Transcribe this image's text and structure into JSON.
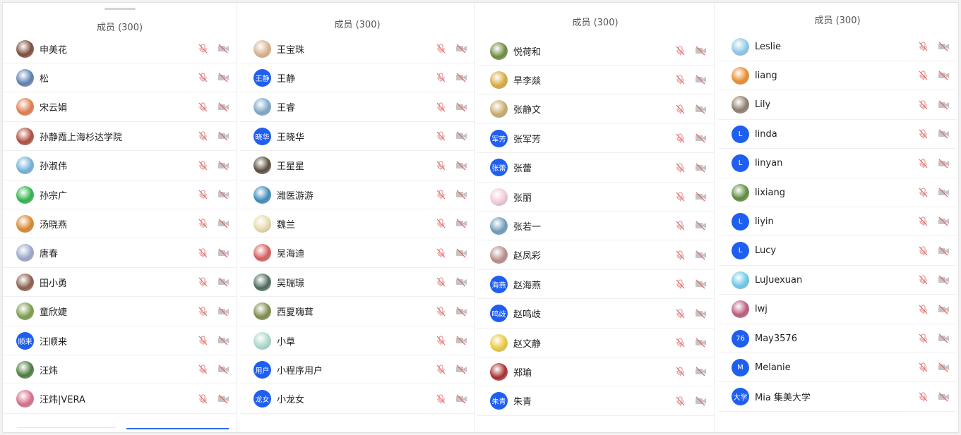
{
  "header_title": "成员 (300)",
  "colors": {
    "avatar_text_bg": "#1f5ff0",
    "muted_icon": "#e9a0a0",
    "camera_icon": "#b9b9b9"
  },
  "icons": {
    "mic": "mic-muted-icon",
    "cam": "camera-off-icon"
  },
  "panels": [
    {
      "title": "成员 (300)",
      "members": [
        {
          "name": "申美花",
          "avatar": "photo",
          "color": "#7a4a3a"
        },
        {
          "name": "松",
          "avatar": "photo",
          "color": "#5a7fb0"
        },
        {
          "name": "宋云娟",
          "avatar": "photo",
          "color": "#e07a4a"
        },
        {
          "name": "孙静霞上海杉达学院",
          "avatar": "photo",
          "color": "#b04a3a"
        },
        {
          "name": "孙淑伟",
          "avatar": "photo",
          "color": "#6fb0d8"
        },
        {
          "name": "孙宗广",
          "avatar": "photo",
          "color": "#2bb34a"
        },
        {
          "name": "汤晓燕",
          "avatar": "photo",
          "color": "#d8862a"
        },
        {
          "name": "唐春",
          "avatar": "photo",
          "color": "#9aa6c8"
        },
        {
          "name": "田小勇",
          "avatar": "photo",
          "color": "#8a5a4a"
        },
        {
          "name": "童欣婕",
          "avatar": "photo",
          "color": "#7a9a4a"
        },
        {
          "name": "汪顺来",
          "avatar": "text",
          "avatar_text": "顺来"
        },
        {
          "name": "汪炜",
          "avatar": "photo",
          "color": "#4a7a3a"
        },
        {
          "name": "汪炜|VERA",
          "avatar": "photo",
          "color": "#d86a8a"
        }
      ]
    },
    {
      "title": "成员 (300)",
      "members": [
        {
          "name": "王宝珠",
          "avatar": "photo",
          "color": "#d8b08a"
        },
        {
          "name": "王静",
          "avatar": "text",
          "avatar_text": "王静"
        },
        {
          "name": "王睿",
          "avatar": "photo",
          "color": "#7aa6c8"
        },
        {
          "name": "王晓华",
          "avatar": "text",
          "avatar_text": "晓华"
        },
        {
          "name": "王星星",
          "avatar": "photo",
          "color": "#5a4a3a"
        },
        {
          "name": "潍医游游",
          "avatar": "photo",
          "color": "#3a8ab8"
        },
        {
          "name": "魏兰",
          "avatar": "photo",
          "color": "#e8d8a8"
        },
        {
          "name": "吴海迪",
          "avatar": "photo",
          "color": "#d85a5a"
        },
        {
          "name": "吴瑞璟",
          "avatar": "photo",
          "color": "#4a6a5a"
        },
        {
          "name": "西夏嗨茸",
          "avatar": "photo",
          "color": "#7a8a4a"
        },
        {
          "name": "小草",
          "avatar": "photo",
          "color": "#a8d8c8"
        },
        {
          "name": "小程序用户",
          "avatar": "text",
          "avatar_text": "用户"
        },
        {
          "name": "小龙女",
          "avatar": "text",
          "avatar_text": "龙女"
        }
      ]
    },
    {
      "title": "成员 (300)",
      "members": [
        {
          "name": "悦荷和",
          "avatar": "photo",
          "color": "#6a8a3a"
        },
        {
          "name": "旱李燚",
          "avatar": "photo",
          "color": "#d8a83a"
        },
        {
          "name": "张静文",
          "avatar": "photo",
          "color": "#c8a86a"
        },
        {
          "name": "张军芳",
          "avatar": "text",
          "avatar_text": "军芳"
        },
        {
          "name": "张蕾",
          "avatar": "text",
          "avatar_text": "张蕾"
        },
        {
          "name": "张丽",
          "avatar": "photo",
          "color": "#f0c8d8"
        },
        {
          "name": "张若一",
          "avatar": "photo",
          "color": "#6a9ab8"
        },
        {
          "name": "赵凤彩",
          "avatar": "photo",
          "color": "#b88a8a"
        },
        {
          "name": "赵海燕",
          "avatar": "text",
          "avatar_text": "海燕"
        },
        {
          "name": "赵鸣歧",
          "avatar": "text",
          "avatar_text": "鸣歧"
        },
        {
          "name": "赵文静",
          "avatar": "photo",
          "color": "#e8c83a"
        },
        {
          "name": "郑瑜",
          "avatar": "photo",
          "color": "#a82a2a"
        },
        {
          "name": "朱青",
          "avatar": "text",
          "avatar_text": "朱青"
        }
      ]
    },
    {
      "title": "成员 (300)",
      "members": [
        {
          "name": "Leslie",
          "avatar": "photo",
          "color": "#8ac8e8"
        },
        {
          "name": "liang",
          "avatar": "photo",
          "color": "#e88a2a"
        },
        {
          "name": "Lily",
          "avatar": "photo",
          "color": "#8a7a6a"
        },
        {
          "name": "linda",
          "avatar": "text",
          "avatar_text": "L"
        },
        {
          "name": "linyan",
          "avatar": "text",
          "avatar_text": "L"
        },
        {
          "name": "lixiang",
          "avatar": "photo",
          "color": "#5a8a3a"
        },
        {
          "name": "liyin",
          "avatar": "text",
          "avatar_text": "L"
        },
        {
          "name": "Lucy",
          "avatar": "text",
          "avatar_text": "L"
        },
        {
          "name": "LuJuexuan",
          "avatar": "photo",
          "color": "#6ac8e8"
        },
        {
          "name": "lwj",
          "avatar": "photo",
          "color": "#b85a7a"
        },
        {
          "name": "May3576",
          "avatar": "text",
          "avatar_text": "76"
        },
        {
          "name": "Melanie",
          "avatar": "text",
          "avatar_text": "M"
        },
        {
          "name": "Mia 集美大学",
          "avatar": "text",
          "avatar_text": "大学"
        }
      ]
    }
  ]
}
